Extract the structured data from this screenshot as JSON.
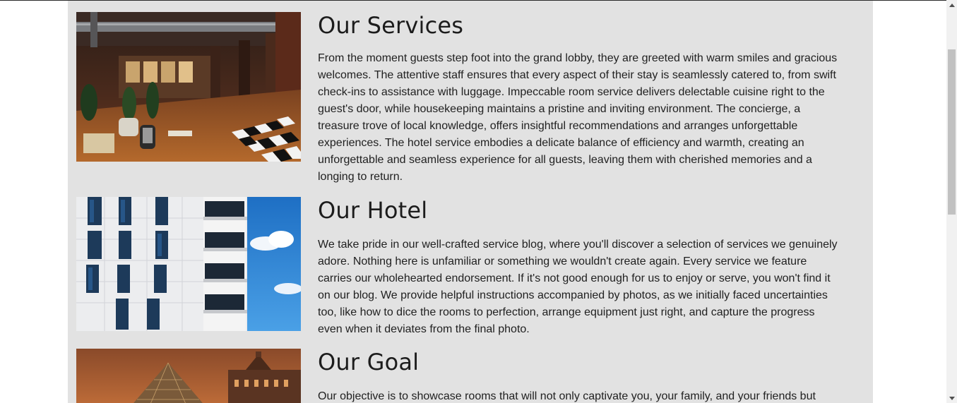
{
  "sections": [
    {
      "heading": "Our Services",
      "image_alt": "hotel-lobby-photo",
      "body": "From the moment guests step foot into the grand lobby, they are greeted with warm smiles and gracious welcomes. The attentive staff ensures that every aspect of their stay is seamlessly catered to, from swift check-ins to assistance with luggage. Impeccable room service delivers delectable cuisine right to the guest's door, while housekeeping maintains a pristine and inviting environment. The concierge, a treasure trove of local knowledge, offers insightful recommendations and arranges unforgettable experiences. The hotel service embodies a delicate balance of efficiency and warmth, creating an unforgettable and seamless experience for all guests, leaving them with cherished memories and a longing to return."
    },
    {
      "heading": "Our Hotel",
      "image_alt": "hotel-building-facade-photo",
      "body": "We take pride in our well-crafted service blog, where you'll discover a selection of services we genuinely adore. Nothing here is unfamiliar or something we wouldn't create again. Every service we feature carries our wholehearted endorsement. If it's not good enough for us to enjoy or serve, you won't find it on our blog. We provide helpful instructions accompanied by photos, as we initially faced uncertainties too, like how to dice the rooms to perfection, arrange equipment just right, and capture the progress even when it deviates from the final photo."
    },
    {
      "heading": "Our Goal",
      "image_alt": "louvre-pyramid-photo",
      "body": "Our objective is to showcase rooms that will not only captivate you, your family, and your friends but"
    }
  ],
  "colors": {
    "page_background": "#e2e2e2",
    "text": "#212121",
    "heading": "#1c1c1c"
  }
}
